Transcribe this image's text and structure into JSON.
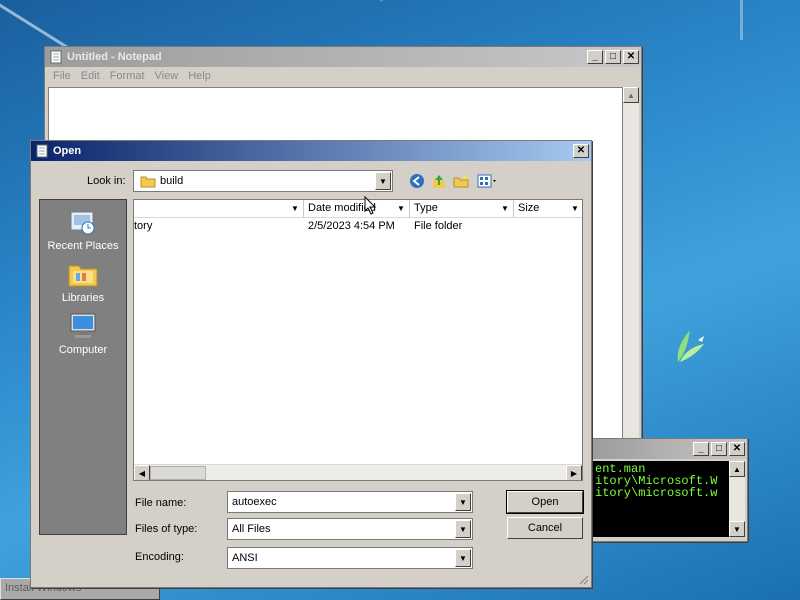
{
  "notepad": {
    "title": "Untitled - Notepad",
    "menu": [
      "File",
      "Edit",
      "Format",
      "View",
      "Help"
    ]
  },
  "console": {
    "lines": [
      "ent.man",
      "itory\\Microsoft.W",
      "itory\\microsoft.w"
    ]
  },
  "taskbar": {
    "item": "Install Windows"
  },
  "dialog": {
    "title": "Open",
    "look_in_label": "Look in:",
    "look_in_value": "build",
    "places": [
      {
        "label": "Recent Places",
        "icon": "recent-places-icon"
      },
      {
        "label": "Libraries",
        "icon": "libraries-icon"
      },
      {
        "label": "Computer",
        "icon": "computer-icon"
      }
    ],
    "columns": [
      "",
      "Date modified",
      "Type",
      "Size"
    ],
    "files": [
      {
        "name": "tory",
        "date": "2/5/2023 4:54 PM",
        "type": "File folder",
        "size": ""
      }
    ],
    "file_name_label": "File name:",
    "file_name_value": "autoexec",
    "file_type_label": "Files of type:",
    "file_type_value": "All Files",
    "encoding_label": "Encoding:",
    "encoding_value": "ANSI",
    "open_label": "Open",
    "cancel_label": "Cancel"
  },
  "colors": {
    "active_title": "#0a246a",
    "console_text": "#7cff3a",
    "desktop": "#2a86c8"
  }
}
